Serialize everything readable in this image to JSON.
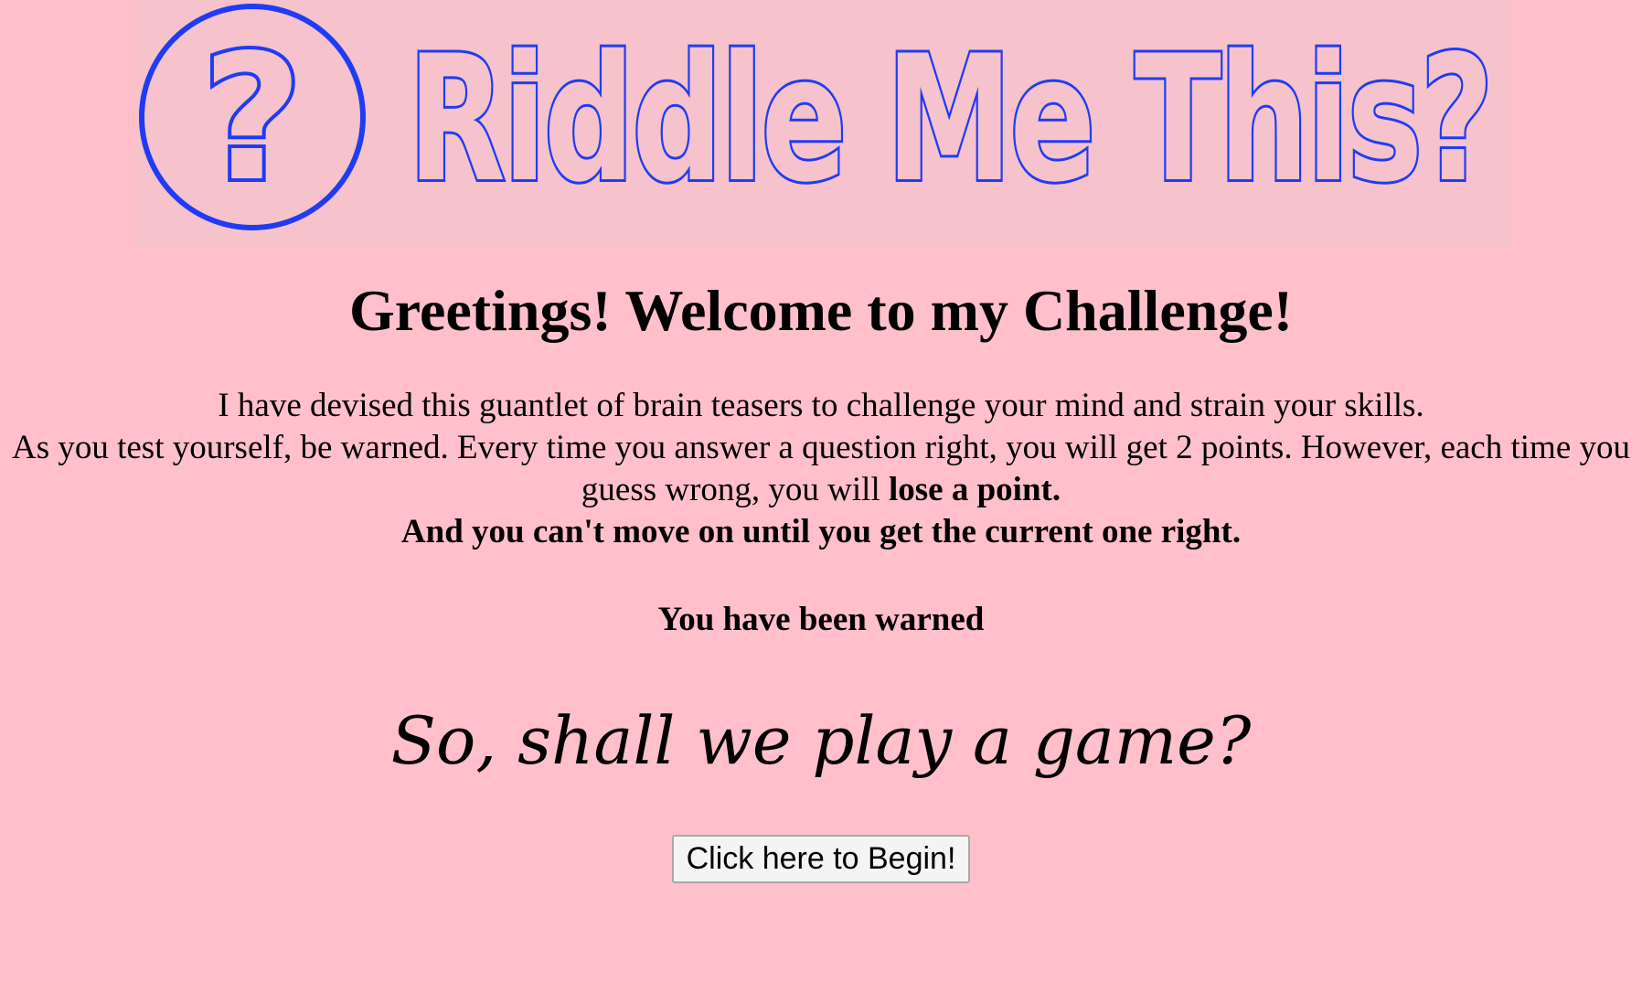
{
  "banner": {
    "title": "Riddle Me This?",
    "icon_glyph": "?",
    "icon": "question-circle-icon",
    "color": "#1f3cf4"
  },
  "heading": "Greetings! Welcome to my Challenge!",
  "intro": {
    "line1": "I have devised this guantlet of brain teasers to challenge your mind and strain your skills.",
    "line2_start": "As you test yourself, be warned. Every time you answer a question right, you will get 2 points. However, each time you guess wrong, you will ",
    "line2_bold": "lose a point.",
    "line3": "And you can't move on until you get the current one right."
  },
  "warned": "You have been warned",
  "invite": "So, shall we play a game?",
  "begin_button": "Click here to Begin!",
  "colors": {
    "background": "#ffc0cb",
    "banner_background": "#f6c2cb",
    "accent": "#1f3cf4"
  }
}
